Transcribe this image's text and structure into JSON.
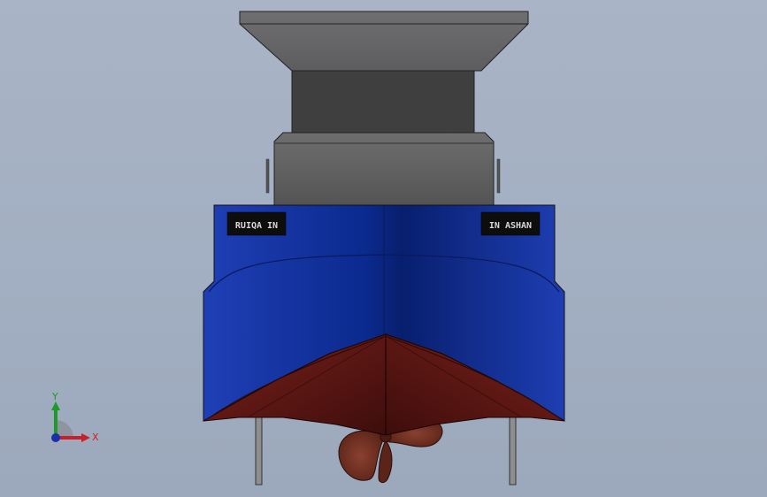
{
  "viewport": {
    "background_top": "#a9b4c6",
    "background_bottom": "#9ca8bb"
  },
  "model": {
    "hull_blue": "#0a2a8a",
    "hull_red": "#6a1a16",
    "cabin_gray": "#5e5e5e",
    "funnel_dark": "#3e3e3e",
    "top_deck_gray": "#6a6a6a",
    "name_plate_left": "RUIQA IN",
    "name_plate_right": "IN ASHAN"
  },
  "triad": {
    "x_label": "X",
    "y_label": "Y",
    "x_color": "#c8202a",
    "y_color": "#1f9a2a",
    "z_color": "#1a2fa8"
  }
}
